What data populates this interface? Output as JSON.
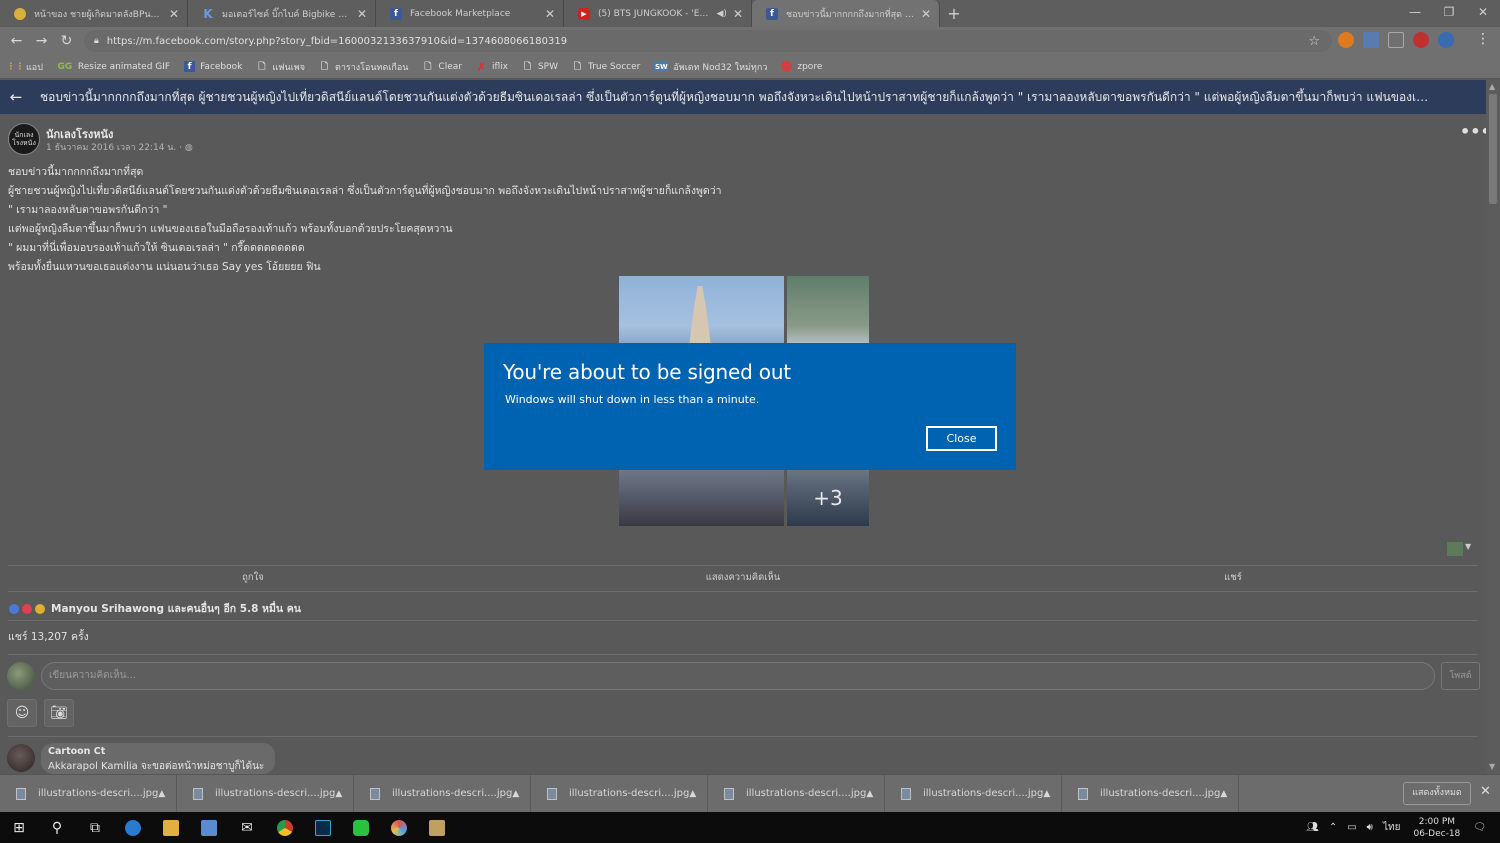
{
  "browser": {
    "tabs": [
      {
        "title": "หน้าของ ชายผู้เกิดมาดลังBPนดังกีตาบ์",
        "favicon_color": "#d8b03a",
        "active": false
      },
      {
        "title": "มอเตอร์ไซค์ บิ๊กไบค์ Bigbike ใน กรุงเ",
        "favicon_color": "#2a5db0",
        "active": false
      },
      {
        "title": "Facebook Marketplace",
        "favicon_color": "#3b5998",
        "active": false
      },
      {
        "title": "(5) BTS JUNGKOOK - 'EUPH",
        "favicon_color": "#d02020",
        "active": false
      },
      {
        "title": "ชอบข่าวนี้มากกกกถึงมากที่สุด ผู้ชายช",
        "favicon_color": "#3b5998",
        "active": true
      }
    ],
    "url": "https://m.facebook.com/story.php?story_fbid=1600032133637910&id=1374608066180319",
    "bookmarks": [
      {
        "label": "แอป",
        "icon": "apps-grid-icon"
      },
      {
        "label": "Resize animated GIF",
        "icon": "gg-icon"
      },
      {
        "label": "Facebook",
        "icon": "facebook-icon"
      },
      {
        "label": "แฟนเพจ",
        "icon": "page-icon"
      },
      {
        "label": "ตารางโอนทดเกือน",
        "icon": "page-icon"
      },
      {
        "label": "Clear",
        "icon": "page-icon"
      },
      {
        "label": "iflix",
        "icon": "iflix-icon"
      },
      {
        "label": "SPW",
        "icon": "page-icon"
      },
      {
        "label": "True Soccer",
        "icon": "page-icon"
      },
      {
        "label": "อัพเดท Nod32 ใหม่ทุกว",
        "icon": "nod32-icon"
      },
      {
        "label": "zpore",
        "icon": "zpore-icon"
      }
    ]
  },
  "fb": {
    "header_title": "ชอบข่าวนี้มากกกกถึงมากที่สุด ผู้ชายชวนผู้หญิงไปเที่ยวดิสนีย์แลนด์โดยชวนกันแต่งตัวด้วยธีมซินเดอเรลล่า ซึ่งเป็นตัวการ์ตูนที่ผู้หญิงชอบมาก พอถึงจังหวะเดินไปหน้าปราสาทผู้ชายก็แกล้งพูดว่า \" เรามาลองหลับตาขอพรกันดีกว่า \" แต่พอผู้หญิงลืมตาขึ้นมาก็พบว่า แฟนของเธอในมื...",
    "page_avatar_text": "นักเลง โรงหนัง",
    "author": "นักเลงโรงหนัง",
    "post_date": "1 ธันวาคม 2016 เวลา 22:14 น. · ",
    "post_lines": [
      "ชอบข่าวนี้มากกกกถึงมากที่สุด",
      "ผู้ชายชวนผู้หญิงไปเที่ยวดิสนีย์แลนด์โดยชวนกันแต่งตัวด้วยธีมซินเดอเรลล่า ซึ่งเป็นตัวการ์ตูนที่ผู้หญิงชอบมาก พอถึงจังหวะเดินไปหน้าปราสาทผู้ชายก็แกล้งพูดว่า",
      "\" เรามาลองหลับตาขอพรกันดีกว่า \"",
      "แต่พอผู้หญิงลืมตาขึ้นมาก็พบว่า แฟนของเธอในมือถือรองเท้าแก้ว พร้อมทั้งบอกด้วยประโยคสุดหวาน",
      "\" ผมมาที่นี่เพื่อมอบรองเท้าแก้วให้ ซินเดอเรลล่า \" กรี๊ดดดดดดดดด",
      "พร้อมทั้งยื่นแหวนขอเธอแต่งงาน แน่นอนว่าเธอ Say yes โอ้ยยยย ฟิน"
    ],
    "more_photos": "+3",
    "actions": {
      "like": "ถูกใจ",
      "comment": "แสดงความคิดเห็น",
      "share": "แชร์"
    },
    "reactions_summary": "Manyou Srihawong และคนอื่นๆ อีก 5.8 หมื่น คน",
    "share_count": "แชร์ 13,207 ครั้ง",
    "comment_placeholder": "เขียนความคิดเห็น...",
    "post_button": "โพสต์",
    "comment": {
      "name": "Cartoon Ct",
      "text": "Akkarapol Kamilia จะขอต่อหน้าหม่อชาบูก็ได้นะ"
    }
  },
  "downloads": {
    "items": [
      "illustrations-descri....jpg",
      "illustrations-descri....jpg",
      "illustrations-descri....jpg",
      "illustrations-descri....jpg",
      "illustrations-descri....jpg",
      "illustrations-descri....jpg",
      "illustrations-descri....jpg"
    ],
    "show_all": "แสดงทั้งหมด"
  },
  "taskbar": {
    "lang": "ไทย",
    "time": "2:00 PM",
    "date": "06-Dec-18"
  },
  "dialog": {
    "title": "You're about to be signed out",
    "message": "Windows will shut down in less than a minute.",
    "close_label": "Close",
    "bg_color": "#0063b1"
  }
}
